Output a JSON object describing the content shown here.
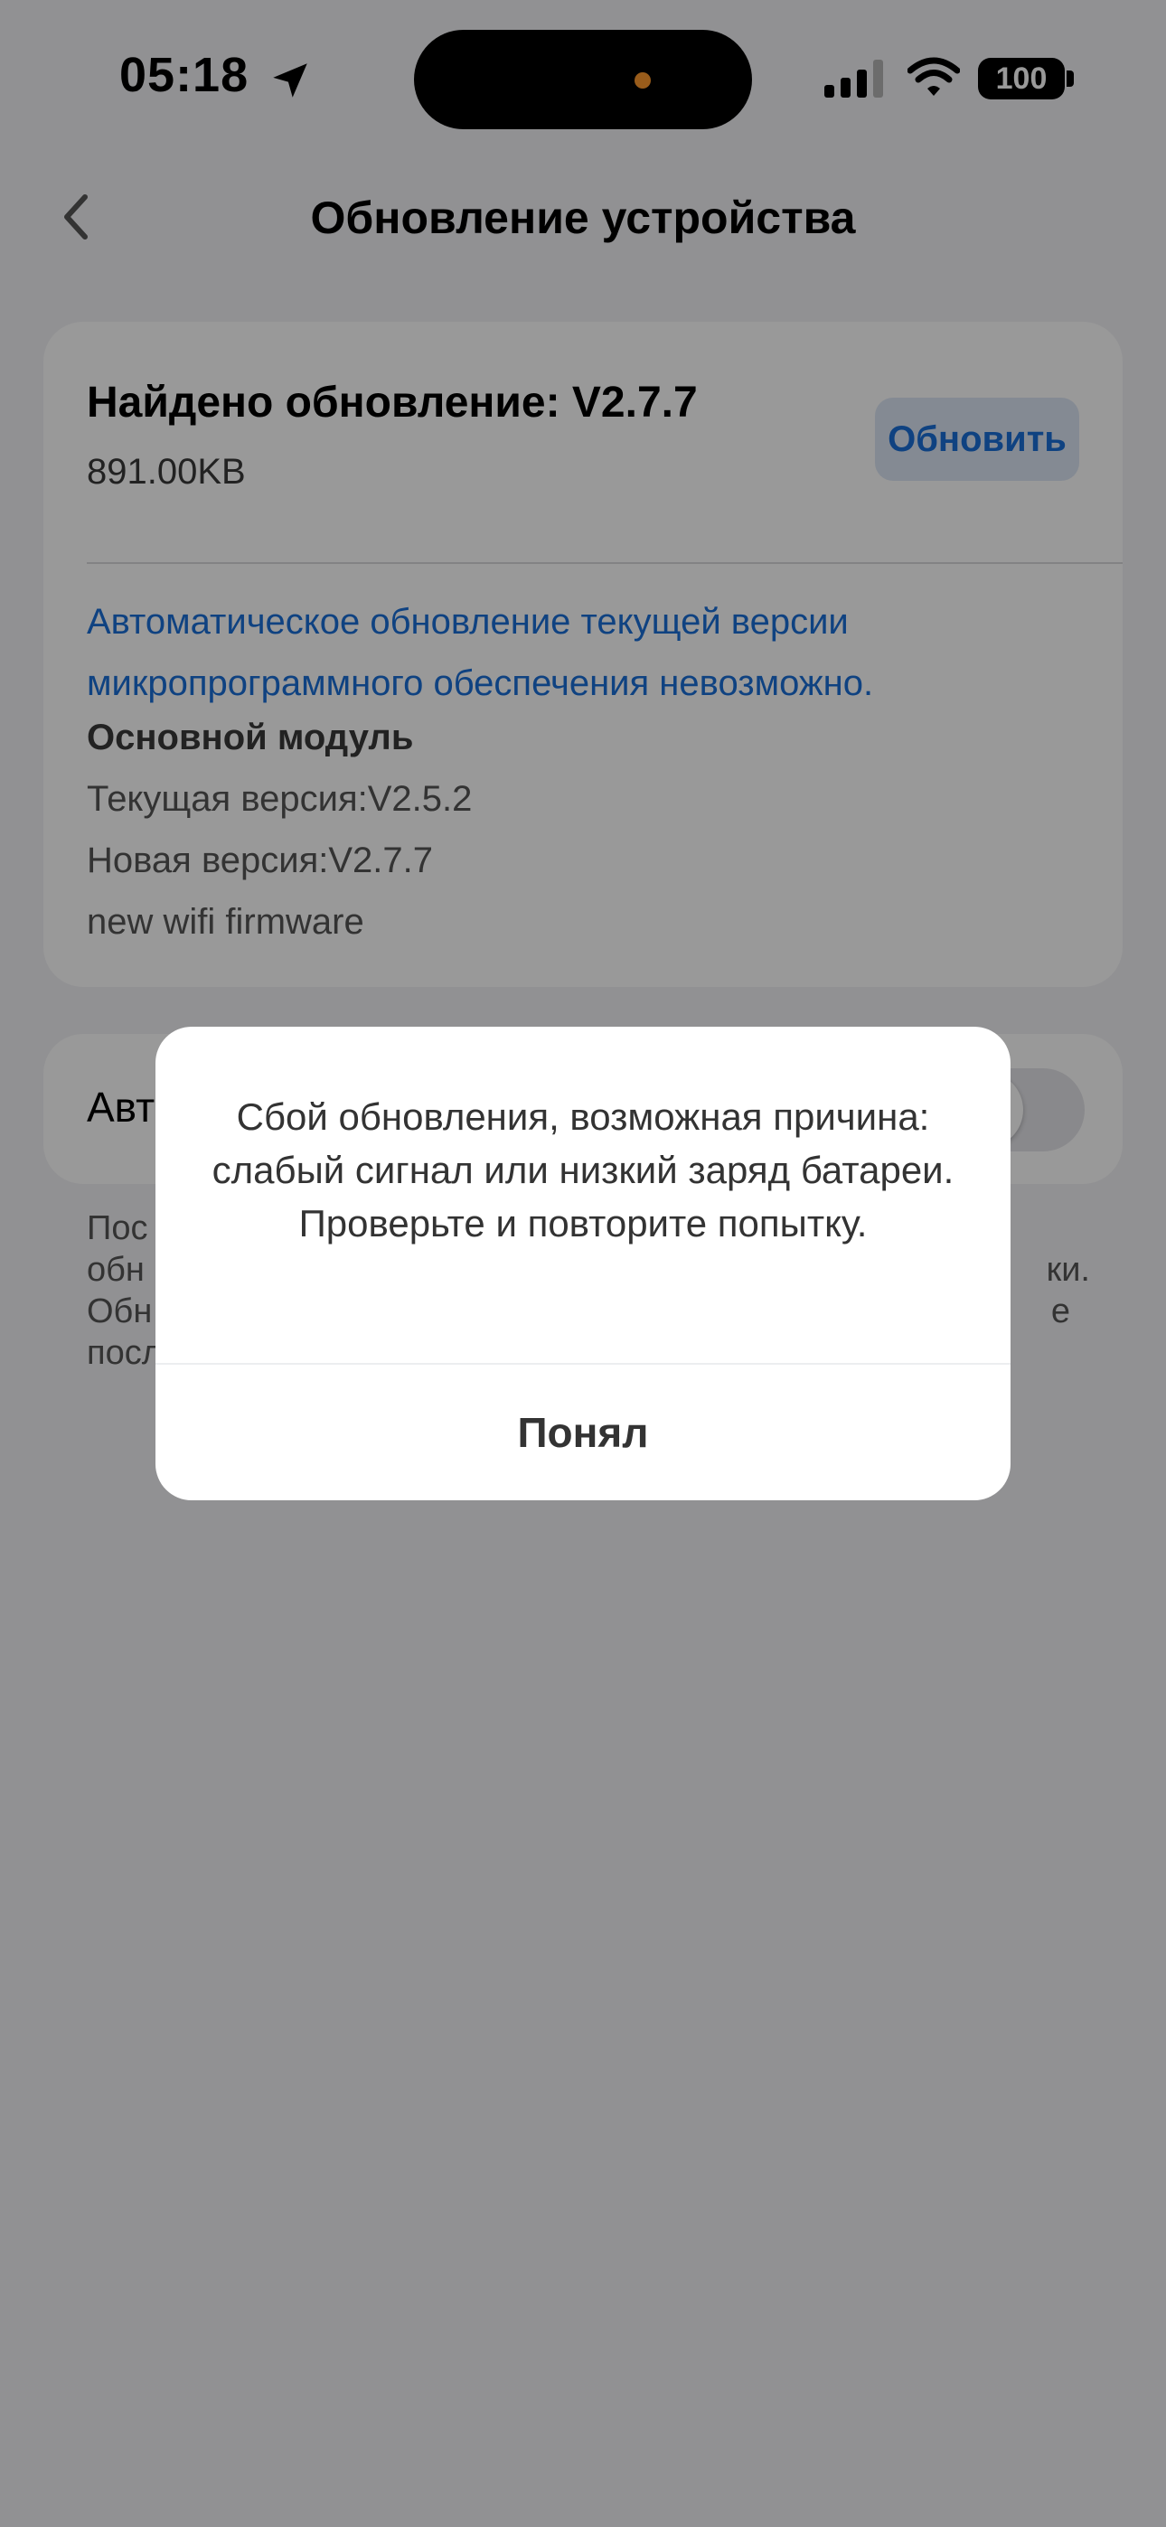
{
  "status_bar": {
    "time": "05:18",
    "battery": "100",
    "icons": [
      "location-arrow-icon",
      "cellular-signal-icon",
      "wifi-icon",
      "battery-icon"
    ]
  },
  "nav": {
    "back_icon": "chevron-left-icon",
    "title": "Обновление устройства"
  },
  "update_card": {
    "title": "Найдено обновление: V2.7.7",
    "size": "891.00KB",
    "update_button": "Обновить",
    "warning": "Автоматическое обновление текущей версии микропрограммного обеспечения невозможно.",
    "module_label": "Основной модуль",
    "current_version": "Текущая версия:V2.5.2",
    "new_version": "Новая версия:V2.7.7",
    "firmware_note": "new wifi firmware"
  },
  "auto_update": {
    "label_visible": "Авт",
    "enabled": false
  },
  "note_partial": {
    "left_lines": [
      "Пос",
      "обн",
      "Обн",
      "посл"
    ],
    "right_fragments": [
      "ки.",
      "е"
    ]
  },
  "dialog": {
    "message": "Сбой обновления, возможная причина: слабый сигнал или низкий заряд батареи. Проверьте и повторите попытку.",
    "ok_button": "Понял"
  },
  "colors": {
    "accent": "#1a6fd8",
    "update_button_bg": "#dce7f5",
    "island_dot": "#ff9a2e"
  }
}
